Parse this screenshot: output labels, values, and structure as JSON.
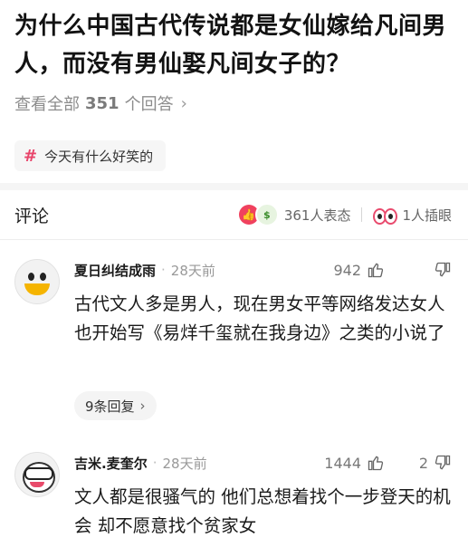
{
  "question": {
    "title": "为什么中国古代传说都是女仙嫁给凡间男人，而没有男仙娶凡间女子的？",
    "view_all_prefix": "查看全部",
    "answer_count": "351",
    "view_all_suffix": "个回答",
    "chevron": "›"
  },
  "tag": {
    "hash": "#",
    "label": "今天有什么好笑的"
  },
  "comments_section": {
    "label": "评论",
    "reactions_text": "361人表态",
    "eyes_text": "1人插眼"
  },
  "comments": [
    {
      "author": "夏日纠结成雨",
      "dot": "·",
      "time": "28天前",
      "likes": "942",
      "dislikes": "",
      "body": "古代文人多是男人，现在男女平等网络发达女人也开始写《易烊千玺就在我身边》之类的小说了",
      "replies": "9条回复",
      "replies_chev": "›"
    },
    {
      "author": "吉米.麦奎尔",
      "dot": "·",
      "time": "28天前",
      "likes": "1444",
      "dislikes": "2",
      "body": "文人都是很骚气的 他们总想着找个一步登天的机会 却不愿意找个贫家女"
    }
  ],
  "colors": {
    "accent": "#e8446a",
    "like_emoji": "#f0415e",
    "muted": "#8c8c8c"
  }
}
